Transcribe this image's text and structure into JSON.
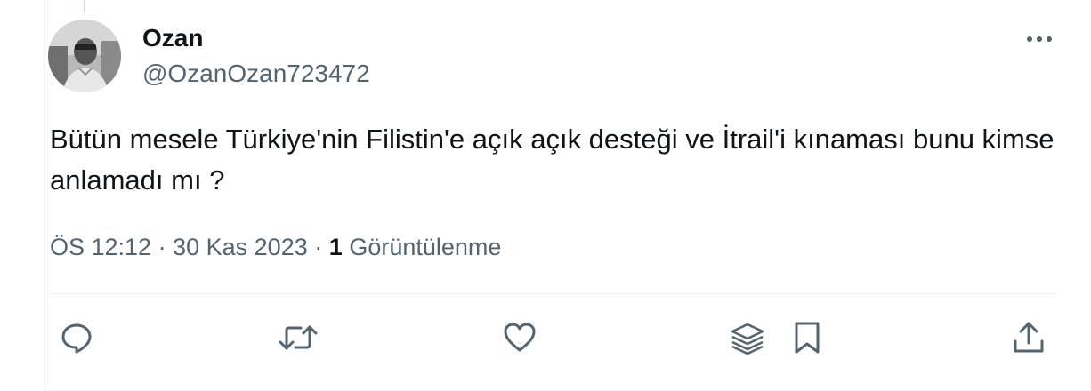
{
  "author": {
    "display_name": "Ozan",
    "handle": "@OzanOzan723472",
    "avatar_icon": "profile-photo"
  },
  "tweet": {
    "text": "Bütün mesele Türkiye'nin Filistin'e açık açık desteği ve İtrail'i kınaması bunu kimse anlamadı mı ?",
    "time": "ÖS 12:12",
    "separator": "·",
    "date": "30 Kas 2023",
    "views_count": "1",
    "views_label": "Görüntülenme"
  },
  "actions": [
    {
      "name": "reply",
      "icon": "reply-icon"
    },
    {
      "name": "retweet",
      "icon": "retweet-icon"
    },
    {
      "name": "like",
      "icon": "heart-icon"
    },
    {
      "name": "grok",
      "icon": "layers-icon"
    },
    {
      "name": "bookmark",
      "icon": "bookmark-icon"
    },
    {
      "name": "share",
      "icon": "share-icon"
    }
  ],
  "colors": {
    "text_primary": "#0f1419",
    "text_secondary": "#536471",
    "divider": "#eff3f4"
  }
}
